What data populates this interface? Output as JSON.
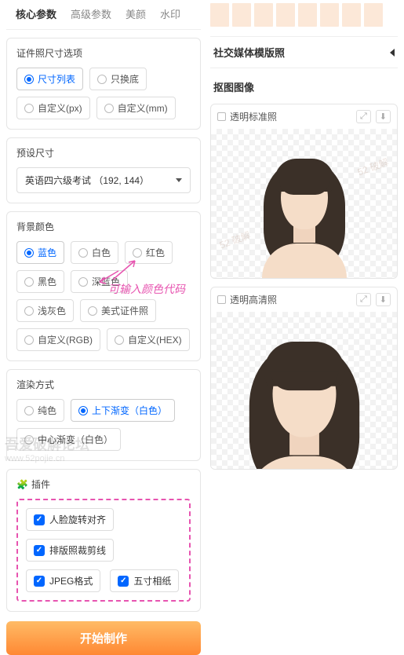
{
  "tabs": [
    "核心参数",
    "高级参数",
    "美颜",
    "水印"
  ],
  "sizeOptions": {
    "title": "证件照尺寸选项",
    "items": [
      "尺寸列表",
      "只换底",
      "自定义(px)",
      "自定义(mm)"
    ]
  },
  "preset": {
    "title": "预设尺寸",
    "value": "英语四六级考试 （192, 144）"
  },
  "bgColor": {
    "title": "背景颜色",
    "items": [
      "蓝色",
      "白色",
      "红色",
      "黑色",
      "深蓝色",
      "浅灰色",
      "美式证件照",
      "自定义(RGB)",
      "自定义(HEX)"
    ]
  },
  "render": {
    "title": "渲染方式",
    "items": [
      "纯色",
      "上下渐变（白色）",
      "中心渐变（白色）"
    ]
  },
  "plugins": {
    "title": "插件",
    "items": [
      "人脸旋转对齐",
      "排版照裁剪线",
      "JPEG格式",
      "五寸相纸"
    ]
  },
  "startBtn": "开始制作",
  "annotation": "可输入颜色代码",
  "right": {
    "social": "社交媒体模版照",
    "cutout": "抠图图像",
    "card1": "透明标准照",
    "card2": "透明高清照"
  },
  "watermark": {
    "line1": "吾爱破解论坛",
    "line2": "www.52pojie.cn",
    "wm2": "52 破解"
  }
}
